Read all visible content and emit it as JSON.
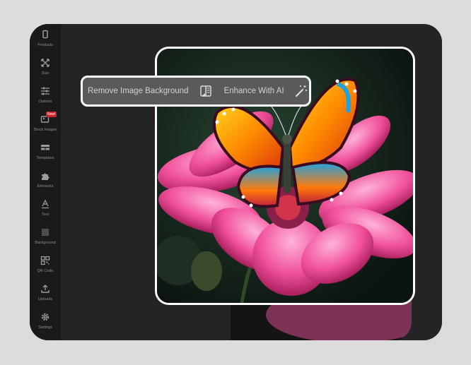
{
  "sidebar": {
    "items": [
      {
        "label": "Products",
        "icon": "phone-case-icon"
      },
      {
        "label": "Size",
        "icon": "resize-arrows-icon"
      },
      {
        "label": "Options",
        "icon": "sliders-icon"
      },
      {
        "label": "Stock Images",
        "icon": "stock-images-icon",
        "badge": "New!"
      },
      {
        "label": "Templates",
        "icon": "templates-icon"
      },
      {
        "label": "Elements",
        "icon": "puzzle-icon"
      },
      {
        "label": "Text",
        "icon": "text-icon"
      },
      {
        "label": "Background",
        "icon": "background-pattern-icon"
      },
      {
        "label": "QR Code",
        "icon": "qr-code-icon"
      },
      {
        "label": "Uploads",
        "icon": "upload-icon"
      },
      {
        "label": "Settings",
        "icon": "gear-icon"
      }
    ]
  },
  "toolbar": {
    "remove_bg_label": "Remove Image Background",
    "remove_bg_icon": "remove-background-icon",
    "enhance_label": "Enhance With AI",
    "enhance_icon": "magic-wand-icon"
  },
  "colors": {
    "frame_bg": "#262626",
    "sidebar_bg": "#1a1a1a",
    "badge": "#c8232c",
    "toolbar_bg": "#5a5a5a",
    "outline": "#ffffff"
  }
}
